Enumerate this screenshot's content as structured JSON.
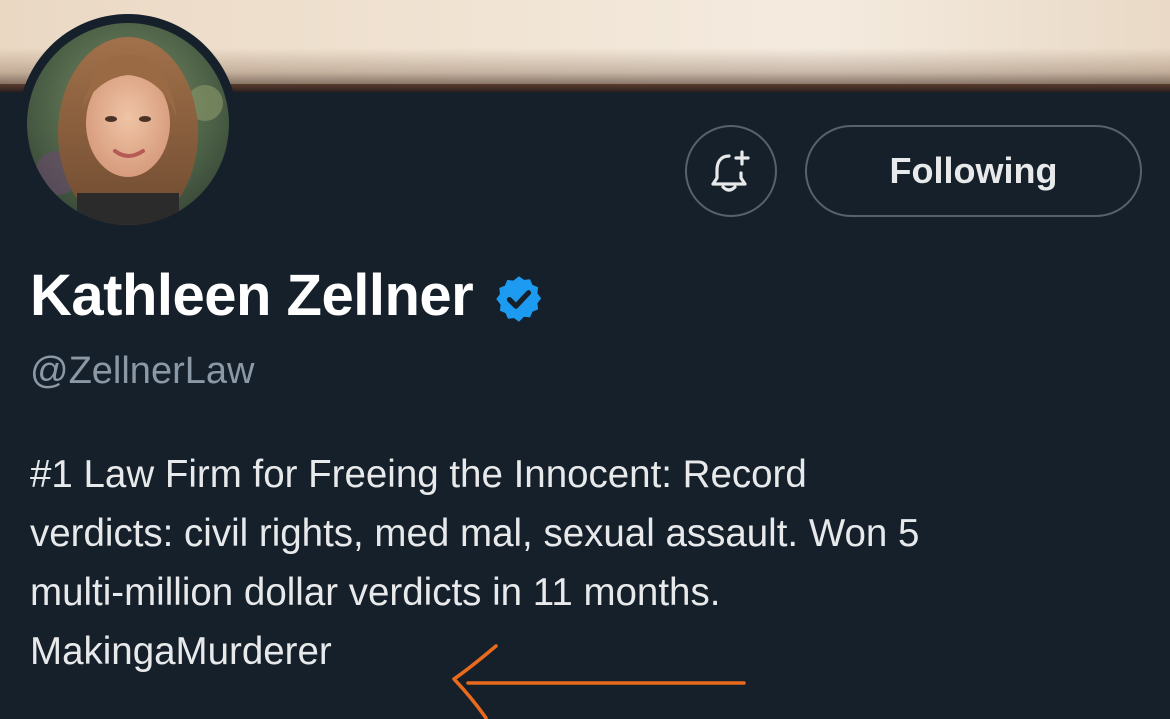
{
  "profile": {
    "name": "Kathleen Zellner",
    "handle": "@ZellnerLaw",
    "verified": true,
    "bio_lines": [
      "#1 Law Firm for Freeing the Innocent: Record",
      "verdicts: civil rights, med mal, sexual assault. Won 5",
      "multi-million dollar verdicts in 11 months.",
      "MakingaMurderer"
    ]
  },
  "actions": {
    "notify_icon": "bell-plus-icon",
    "follow_label": "Following"
  },
  "icons": {
    "verified": "verified-badge-icon",
    "annotation": "orange-arrow-annotation"
  },
  "colors": {
    "background": "#15202b",
    "verified_blue": "#1d9bf0",
    "handle_gray": "#8b98a5",
    "text": "#e7e9ea",
    "border": "#56636f",
    "annotation_orange": "#e96a1d"
  }
}
